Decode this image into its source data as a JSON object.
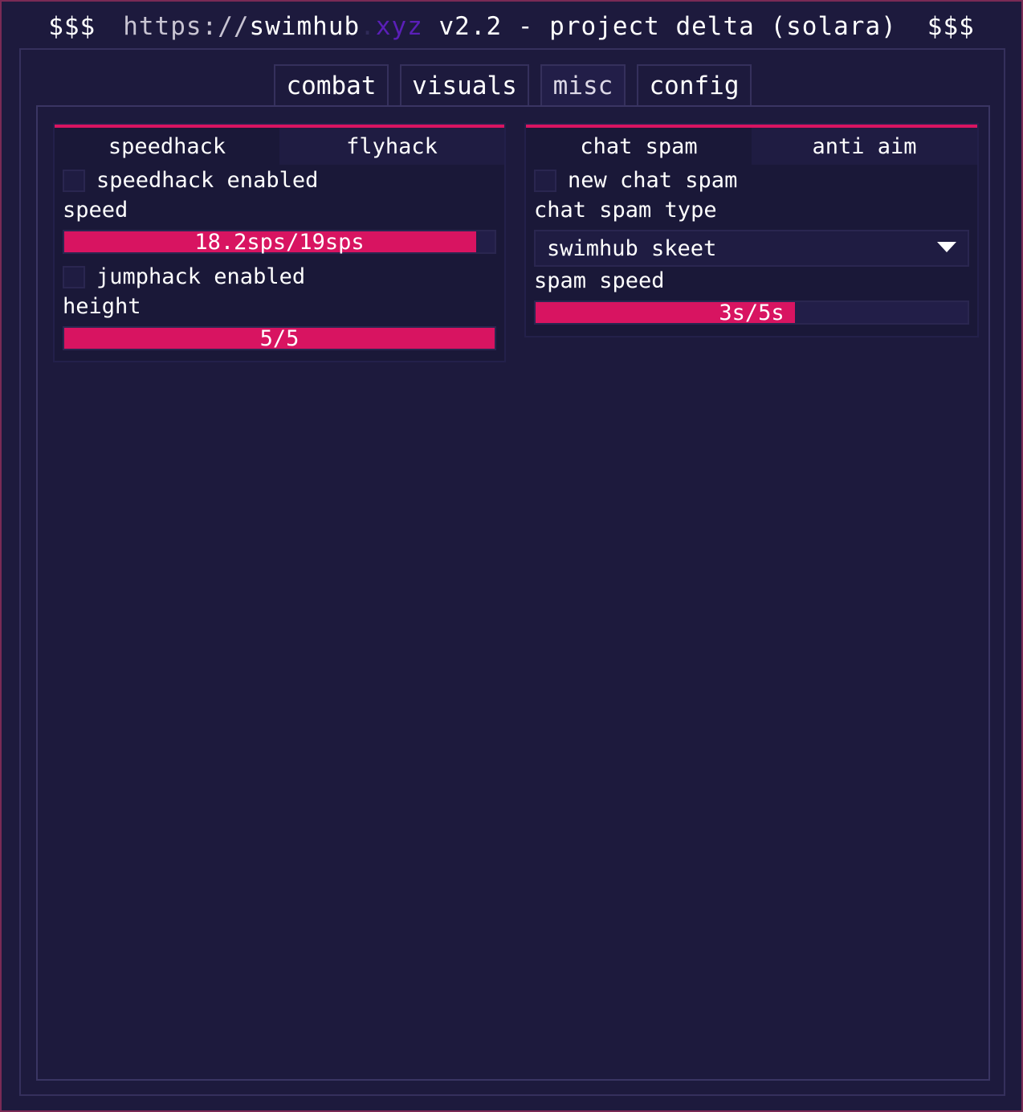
{
  "title": {
    "left": "$$$",
    "url_prefix": "https://",
    "url_name": "swimhub",
    "url_dot": ".",
    "url_tld": "xyz",
    "rest": " v2.2 - project delta (solara)",
    "right": "$$$"
  },
  "tabs": [
    {
      "label": "combat"
    },
    {
      "label": "visuals"
    },
    {
      "label": "misc"
    },
    {
      "label": "config"
    }
  ],
  "active_tab": "misc",
  "left_panel": {
    "tabs": [
      {
        "label": "speedhack"
      },
      {
        "label": "flyhack"
      }
    ],
    "active_tab": "speedhack",
    "speedhack_enabled": {
      "label": "speedhack enabled",
      "checked": false
    },
    "speed": {
      "label": "speed",
      "display": "18.2sps/19sps",
      "value": 18.2,
      "max": 19
    },
    "jumphack_enabled": {
      "label": "jumphack enabled",
      "checked": false
    },
    "height": {
      "label": "height",
      "display": "5/5",
      "value": 5,
      "max": 5
    }
  },
  "right_panel": {
    "tabs": [
      {
        "label": "chat spam"
      },
      {
        "label": "anti aim"
      }
    ],
    "active_tab": "chat spam",
    "new_chat_spam": {
      "label": "new chat spam",
      "checked": false
    },
    "chat_spam_type": {
      "label": "chat spam type",
      "selected": "swimhub skeet"
    },
    "spam_speed": {
      "label": "spam speed",
      "display": "3s/5s",
      "value": 3,
      "max": 5
    }
  },
  "colors": {
    "accent": "#d81461",
    "background": "#1d1a3d",
    "panel": "#1a1838",
    "border": "#35305c",
    "tld": "#5a1fb8"
  }
}
